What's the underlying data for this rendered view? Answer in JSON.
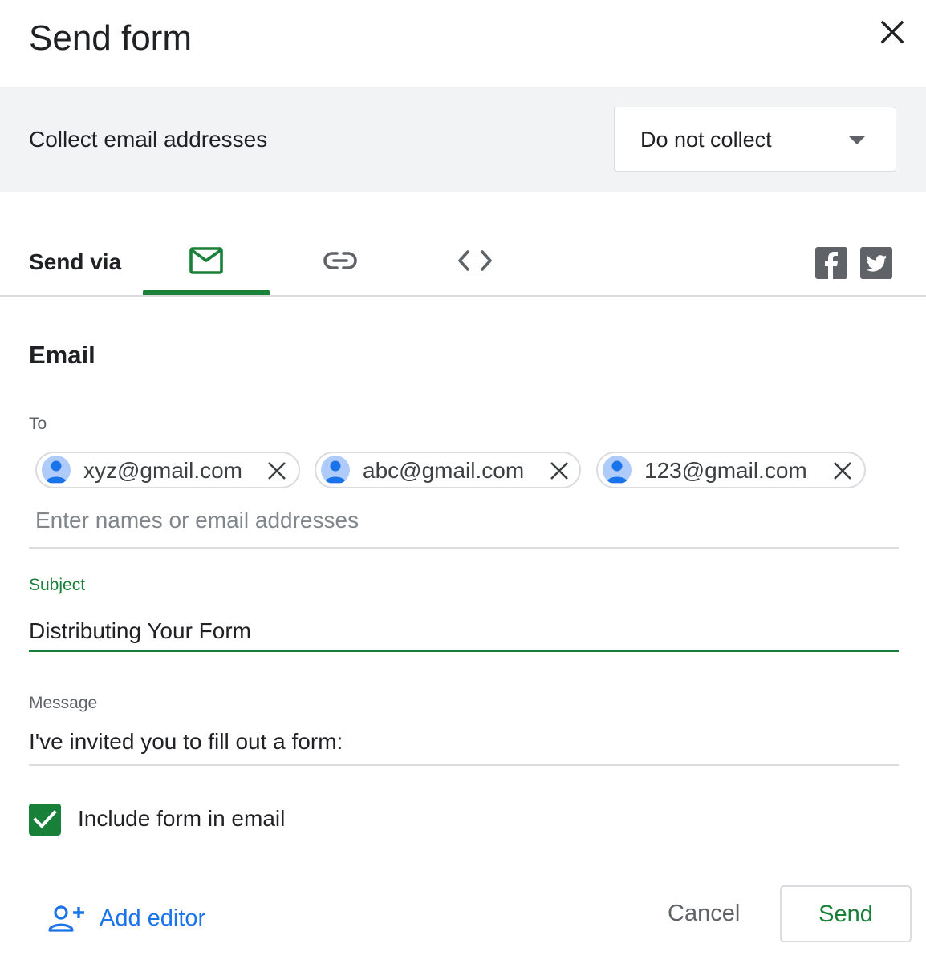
{
  "dialog": {
    "title": "Send form"
  },
  "collect": {
    "label": "Collect email addresses",
    "selected": "Do not collect"
  },
  "send_via": {
    "label": "Send via",
    "tabs": [
      {
        "icon": "mail-icon",
        "active": true
      },
      {
        "icon": "link-icon",
        "active": false
      },
      {
        "icon": "embed-code-icon",
        "active": false
      }
    ],
    "share": [
      "facebook-icon",
      "twitter-icon"
    ]
  },
  "email": {
    "heading": "Email",
    "to_label": "To",
    "recipients": [
      "xyz@gmail.com",
      "abc@gmail.com",
      "123@gmail.com"
    ],
    "to_placeholder": "Enter names or email addresses",
    "subject_label": "Subject",
    "subject_value": "Distributing Your Form",
    "message_label": "Message",
    "message_value": "I've invited you to fill out a form:",
    "include_form_label": "Include form in email",
    "include_form_checked": true
  },
  "footer": {
    "add_editor": "Add editor",
    "cancel": "Cancel",
    "send": "Send"
  },
  "colors": {
    "accent_green": "#188038",
    "link_blue": "#1a73e8",
    "bar_gray": "#f1f3f4"
  }
}
